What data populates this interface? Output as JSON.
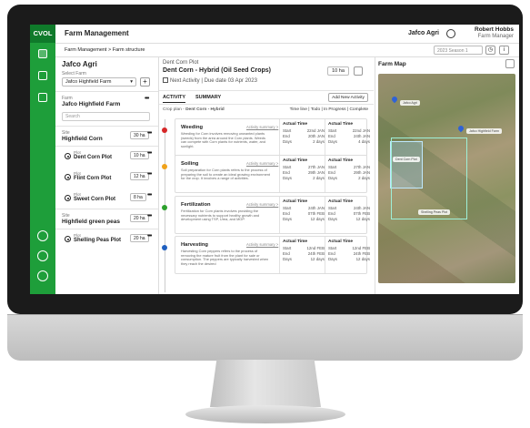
{
  "header": {
    "app_title": "Farm Management",
    "org": "Jafco Agri",
    "user_name": "Robert Hobbs",
    "user_role": "Farm Manager"
  },
  "brand": {
    "logo": "CVOL",
    "accent": "#1e9e3a"
  },
  "subbar": {
    "breadcrumb": "Farm Management  >  Farm structure",
    "season": "2023 Season 1"
  },
  "farm_panel": {
    "title": "Jafco Agri",
    "select_label": "Select Farm",
    "selected_farm": "Jafco Highfield Farm",
    "farm_label": "Farm",
    "farm_name": "Jafco Highfield Farm",
    "search_placeholder": "Search",
    "sites": [
      {
        "label": "Site",
        "name": "Highfield Corn",
        "ha": "30 ha",
        "plots": [
          {
            "label": "Plot",
            "name": "Dent Corn Plot",
            "ha": "10 ha"
          },
          {
            "label": "Plot",
            "name": "Flint Corn Plot",
            "ha": "12 ha"
          },
          {
            "label": "Plot",
            "name": "Sweet Corn Plot",
            "ha": "8 ha"
          }
        ]
      },
      {
        "label": "Site",
        "name": "Highfield green peas",
        "ha": "20 ha",
        "plots": [
          {
            "label": "Plot",
            "name": "Shelling Peas Plot",
            "ha": "20 ha"
          }
        ]
      }
    ]
  },
  "plot": {
    "subtitle": "Dent Corn Plot",
    "title": "Dent Corn - Hybrid (Oil Seed Crops)",
    "next_activity": "Next Activity | Due date 03 Apr 2023",
    "ha": "10 ha",
    "tabs": [
      "ACTIVITY",
      "SUMMARY"
    ],
    "add_activity": "Add New Activity",
    "crop_plan_label": "Crop plan -",
    "crop_plan_value": "Dent Corn - Hybrid",
    "view_toggle": "Time line | Todo | In Progress | Complete",
    "activities": [
      {
        "title": "Weeding",
        "link": "Activity summary >",
        "color": "#d62728",
        "desc": "Weeding for Corn involves removing unwanted plants (weeds) from the area around the Corn plants. Weeds can compete with Corn plants for nutrients, water, and sunlight.",
        "actual1": {
          "head": "Actual Time",
          "start": "22nd JAN",
          "end": "20th JAN",
          "days": "2 days"
        },
        "actual2": {
          "head": "Actual Time",
          "start": "22nd JAN",
          "end": "24th JAN",
          "days": "4 days"
        }
      },
      {
        "title": "Soiling",
        "link": "Activity summary >",
        "color": "#f0a21a",
        "desc": "Soil preparation for Corn plants refers to the process of preparing the soil to create an ideal growing environment for the crop. It involves a range of activities.",
        "actual1": {
          "head": "Actual Time",
          "start": "27th JAN",
          "end": "29th JAN",
          "days": "2 days"
        },
        "actual2": {
          "head": "Actual Time",
          "start": "27th JAN",
          "end": "29th JAN",
          "days": "2 days"
        }
      },
      {
        "title": "Fertilization",
        "link": "Activity summary >",
        "color": "#2ca02c",
        "desc": "Fertilization for Corn plants involves providing the necessary nutrients to support healthy growth and development using TSP, Urea, and MOP.",
        "actual1": {
          "head": "Actual Time",
          "start": "24th JAN",
          "end": "07th FEB",
          "days": "12 days"
        },
        "actual2": {
          "head": "Actual Time",
          "start": "24th JAN",
          "end": "07th FEB",
          "days": "12 days"
        }
      },
      {
        "title": "Harvesting",
        "link": "Activity summary >",
        "color": "#1f5fbf",
        "desc": "Harvesting Corn peppers refers to the process of removing the mature fruit from the plant for sale or consumption. The peppers are typically harvested when they reach the desired",
        "actual1": {
          "head": "Actual Time",
          "start": "12nd FEB",
          "end": "24th FEB",
          "days": "12 days"
        },
        "actual2": {
          "head": "Actual Time",
          "start": "12nd FEB",
          "end": "24th FEB",
          "days": "12 days"
        }
      }
    ],
    "row_labels": {
      "start": "Start",
      "end": "End",
      "days": "Days"
    }
  },
  "map": {
    "title": "Farm Map",
    "tags": [
      "Jafco Agri",
      "Jafco Highfield Farm",
      "Dent Corn Plot",
      "Shelling Peas Plot"
    ]
  }
}
